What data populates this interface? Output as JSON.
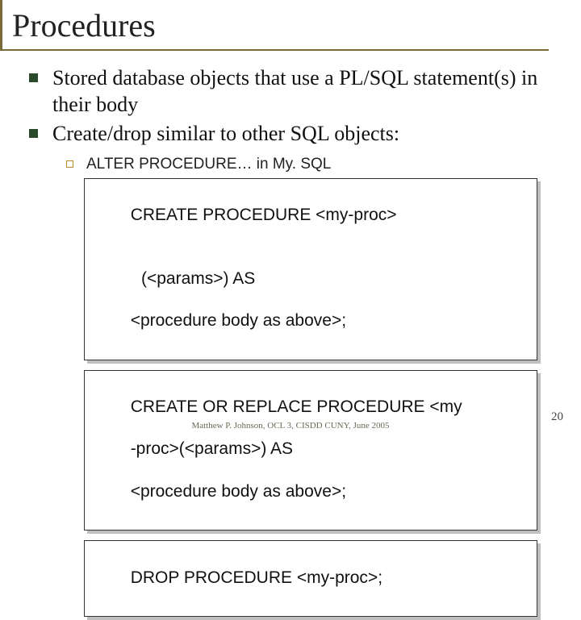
{
  "title": "Procedures",
  "bullets": [
    "Stored database objects that use a PL/SQL statement(s) in their body",
    "Create/drop similar to other SQL objects:"
  ],
  "sub_bullet": "ALTER PROCEDURE… in My. SQL",
  "code_boxes": [
    {
      "lines": [
        "CREATE PROCEDURE <my-proc>",
        "(<params>) AS",
        "<procedure body as above>;"
      ],
      "indent_line_index": 1
    },
    {
      "lines": [
        "CREATE OR REPLACE PROCEDURE <my",
        "-proc>(<params>) AS",
        "<procedure body as above>;"
      ],
      "indent_line_index": -1
    },
    {
      "lines": [
        "DROP PROCEDURE <my-proc>;"
      ],
      "indent_line_index": -1
    }
  ],
  "footer": "Matthew P. Johnson, OCL 3, CISDD CUNY, June 2005",
  "page_number": "20"
}
